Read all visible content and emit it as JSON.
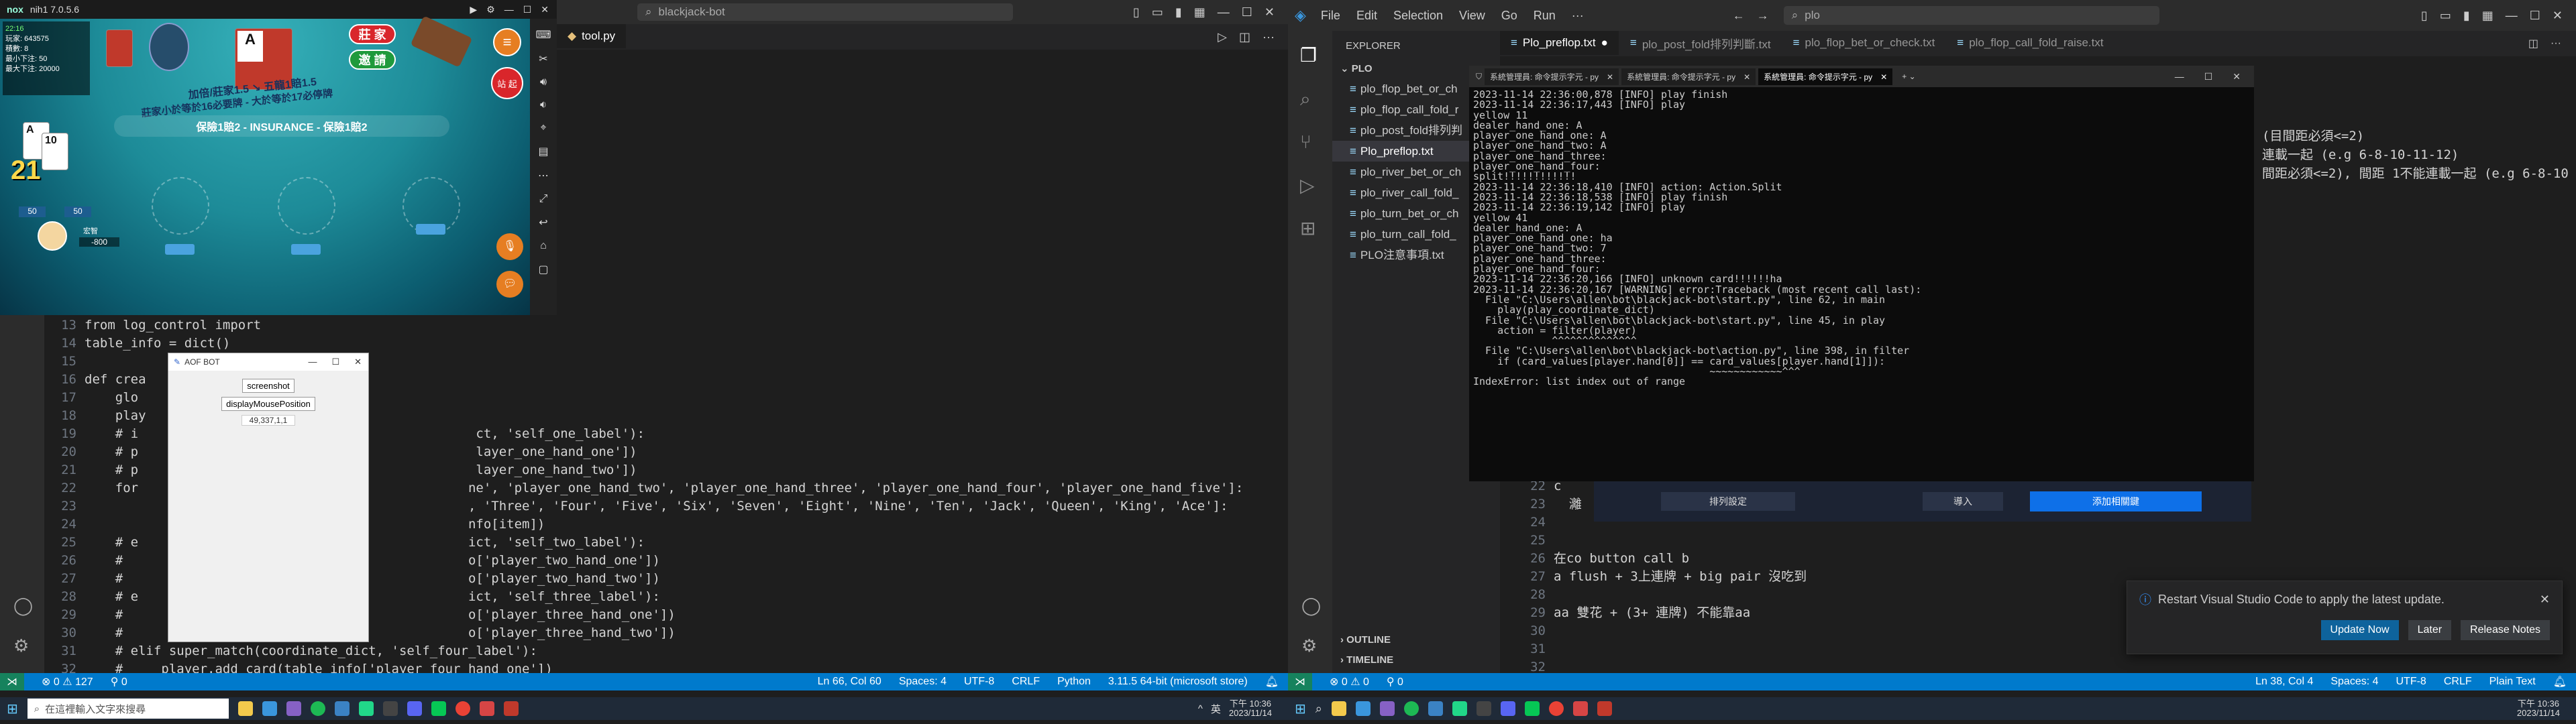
{
  "game": {
    "window_title": "nih1 7.0.5.6",
    "brand": "nox",
    "player_id": "玩家: 643575",
    "points": "積數: 8",
    "min_bet": "最小下注: 50",
    "max_bet": "最大下注: 20000",
    "btn_stay": "莊 家",
    "btn_invite": "邀 請",
    "btn_stand": "站 起",
    "table_text_1": "加倍/莊家1.5 ↘ 五龍1賠1.5",
    "table_text_2": "莊家小於等於16必要牌 - 大於等於17必停牌",
    "table_text_3": "保險1賠2 - INSURANCE - 保險1賠2",
    "player_name": "宏智",
    "player_score": "-800",
    "bet_left": "50",
    "bet_right": "50",
    "hand_count": "21",
    "card_hand": [
      "A",
      "10"
    ],
    "dealer_card": "A",
    "time_label": "22:16"
  },
  "left_vscode": {
    "title_search": "blackjack-bot",
    "tab_label": "tool.py",
    "code_lines": [
      {
        "n": "13",
        "t": "from log_control import"
      },
      {
        "n": "14",
        "t": "table_info = dict()"
      },
      {
        "n": "15",
        "t": ""
      },
      {
        "n": "16",
        "t": "def crea"
      },
      {
        "n": "17",
        "t": "    glo"
      },
      {
        "n": "18",
        "t": "    play"
      },
      {
        "n": "19",
        "t": "    # i                                            ct, 'self_one_label'):"
      },
      {
        "n": "20",
        "t": "    # p                                            layer_one_hand_one'])"
      },
      {
        "n": "21",
        "t": "    # p                                            layer_one_hand_two'])"
      },
      {
        "n": "22",
        "t": "    for                                           ne', 'player_one_hand_two', 'player_one_hand_three', 'player_one_hand_four', 'player_one_hand_five']:"
      },
      {
        "n": "23",
        "t": "                                                  , 'Three', 'Four', 'Five', 'Six', 'Seven', 'Eight', 'Nine', 'Ten', 'Jack', 'Queen', 'King', 'Ace']:"
      },
      {
        "n": "24",
        "t": "                                                  nfo[item])"
      },
      {
        "n": "25",
        "t": "    # e                                           ict, 'self_two_label'):"
      },
      {
        "n": "26",
        "t": "    #                                             o['player_two_hand_one'])"
      },
      {
        "n": "27",
        "t": "    #                                             o['player_two_hand_two'])"
      },
      {
        "n": "28",
        "t": "    # e                                           ict, 'self_three_label'):"
      },
      {
        "n": "29",
        "t": "    #                                             o['player_three_hand_one'])"
      },
      {
        "n": "30",
        "t": "    #                                             o['player_three_hand_two'])"
      },
      {
        "n": "31",
        "t": "    # elif super_match(coordinate_dict, 'self_four_label'):"
      },
      {
        "n": "32",
        "t": "    #     player.add_card(table_info['player_four_hand_one'])"
      }
    ],
    "status": {
      "errors": "⊗ 0 ⚠ 127",
      "ports": "⚲ 0",
      "pos": "Ln 66, Col 60",
      "spaces": "Spaces: 4",
      "enc": "UTF-8",
      "eol": "CRLF",
      "lang": "Python",
      "interp": "3.11.5 64-bit (microsoft store)"
    }
  },
  "aofbot": {
    "title": "AOF BOT",
    "btn_screenshot": "screenshot",
    "btn_mouse": "displayMousePosition",
    "coord_text": "49,337,1,1"
  },
  "right_vscode": {
    "menu": [
      "File",
      "Edit",
      "Selection",
      "View",
      "Go",
      "Run",
      "···"
    ],
    "search": "plo",
    "tabs": [
      "Plo_preflop.txt",
      "plo_post_fold排列判斷.txt",
      "plo_flop_bet_or_check.txt",
      "plo_flop_call_fold_raise.txt"
    ],
    "explorer_title": "EXPLORER",
    "folder": "PLO",
    "files": [
      "plo_flop_bet_or_ch",
      "plo_flop_call_fold_r",
      "plo_post_fold排列判",
      "Plo_preflop.txt",
      "plo_river_bet_or_ch",
      "plo_river_call_fold_",
      "plo_turn_bet_or_ch",
      "plo_turn_call_fold_",
      "PLO注意事項.txt"
    ],
    "outline": "OUTLINE",
    "timeline": "TIMELINE",
    "editor_right_lines": [
      "(目間距必須<=2)",
      "連載一起 (e.g 6-8-10-11-12)",
      "間距必須<=2),  間距 1不能連載一起 (e.g 6-8-10"
    ],
    "editor_lines": [
      {
        "n": "22",
        "t": "c"
      },
      {
        "n": "23",
        "t": "  灕"
      },
      {
        "n": "24",
        "t": ""
      },
      {
        "n": "25",
        "t": ""
      },
      {
        "n": "26",
        "t": "在co button call b"
      },
      {
        "n": "27",
        "t": "a flush + 3上連牌 + big pair 沒吃到"
      },
      {
        "n": "28",
        "t": ""
      },
      {
        "n": "29",
        "t": "aa 雙花 + (3+ 連牌) 不能靠aa"
      },
      {
        "n": "30",
        "t": ""
      },
      {
        "n": "31",
        "t": ""
      },
      {
        "n": "32",
        "t": ""
      },
      {
        "n": "33",
        "t": ""
      }
    ],
    "notif_text": "Restart Visual Studio Code to apply the latest update.",
    "notif_update": "Update Now",
    "notif_later": "Later",
    "notif_notes": "Release Notes",
    "panel_btn_a": "排列設定",
    "panel_btn_b": "導入",
    "panel_btn_c": "添加相關鍵",
    "status": {
      "errors": "⊗ 0 ⚠ 0",
      "ports": "⚲ 0",
      "pos": "Ln 38, Col 4",
      "spaces": "Spaces: 4",
      "enc": "UTF-8",
      "eol": "CRLF",
      "lang": "Plain Text"
    }
  },
  "terminal": {
    "tabs": [
      "系統管理員: 命令提示字元 - py",
      "系統管理員: 命令提示字元 - py",
      "系統管理員: 命令提示字元 - py"
    ],
    "lines": [
      "2023-11-14 22:36:00,878 [INFO] play finish",
      "2023-11-14 22:36:17,443 [INFO] play",
      "yellow 11",
      "dealer_hand_one: A",
      "player_one_hand_one: A",
      "player_one_hand_two: A",
      "player_one_hand_three:",
      "player_one_hand_four:",
      "split!!!!!!!!!!!!",
      "2023-11-14 22:36:18,410 [INFO] action: Action.Split",
      "2023-11-14 22:36:18,538 [INFO] play finish",
      "2023-11-14 22:36:19,142 [INFO] play",
      "yellow 41",
      "dealer_hand_one: A",
      "player_one_hand_one: ha",
      "player_one_hand_two: 7",
      "player_one_hand_three:",
      "player_one_hand_four:",
      "2023-11-14 22:36:20,166 [INFO] unknown card!!!!!!ha",
      "2023-11-14 22:36:20,167 [WARNING] error:Traceback (most recent call last):",
      "  File \"C:\\Users\\allen\\bot\\blackjack-bot\\start.py\", line 62, in main",
      "    play(play_coordinate_dict)",
      "  File \"C:\\Users\\allen\\bot\\blackjack-bot\\start.py\", line 45, in play",
      "    action = filter(player)",
      "             ^^^^^^^^^^^^^^",
      "  File \"C:\\Users\\allen\\bot\\blackjack-bot\\action.py\", line 398, in filter",
      "    if (card_values[player.hand[0]] == card_values[player.hand[1]]):",
      "                                       ~~~~~~~~~~~~^^^",
      "IndexError: list index out of range",
      ""
    ]
  },
  "taskbar_left": {
    "search_placeholder": "在這裡輸入文字來搜尋",
    "time": "下午 10:36",
    "date": "2023/11/14",
    "lang": "英"
  },
  "taskbar_right": {
    "time": "下午 10:36",
    "date": "2023/11/14"
  },
  "colors": {
    "accent": "#007acc",
    "status_left": "#007acc",
    "vscode_bg": "#1e1e1e",
    "sidebar": "#252526",
    "red_btn": "#d9262b",
    "green_btn": "#1f9a3c"
  }
}
